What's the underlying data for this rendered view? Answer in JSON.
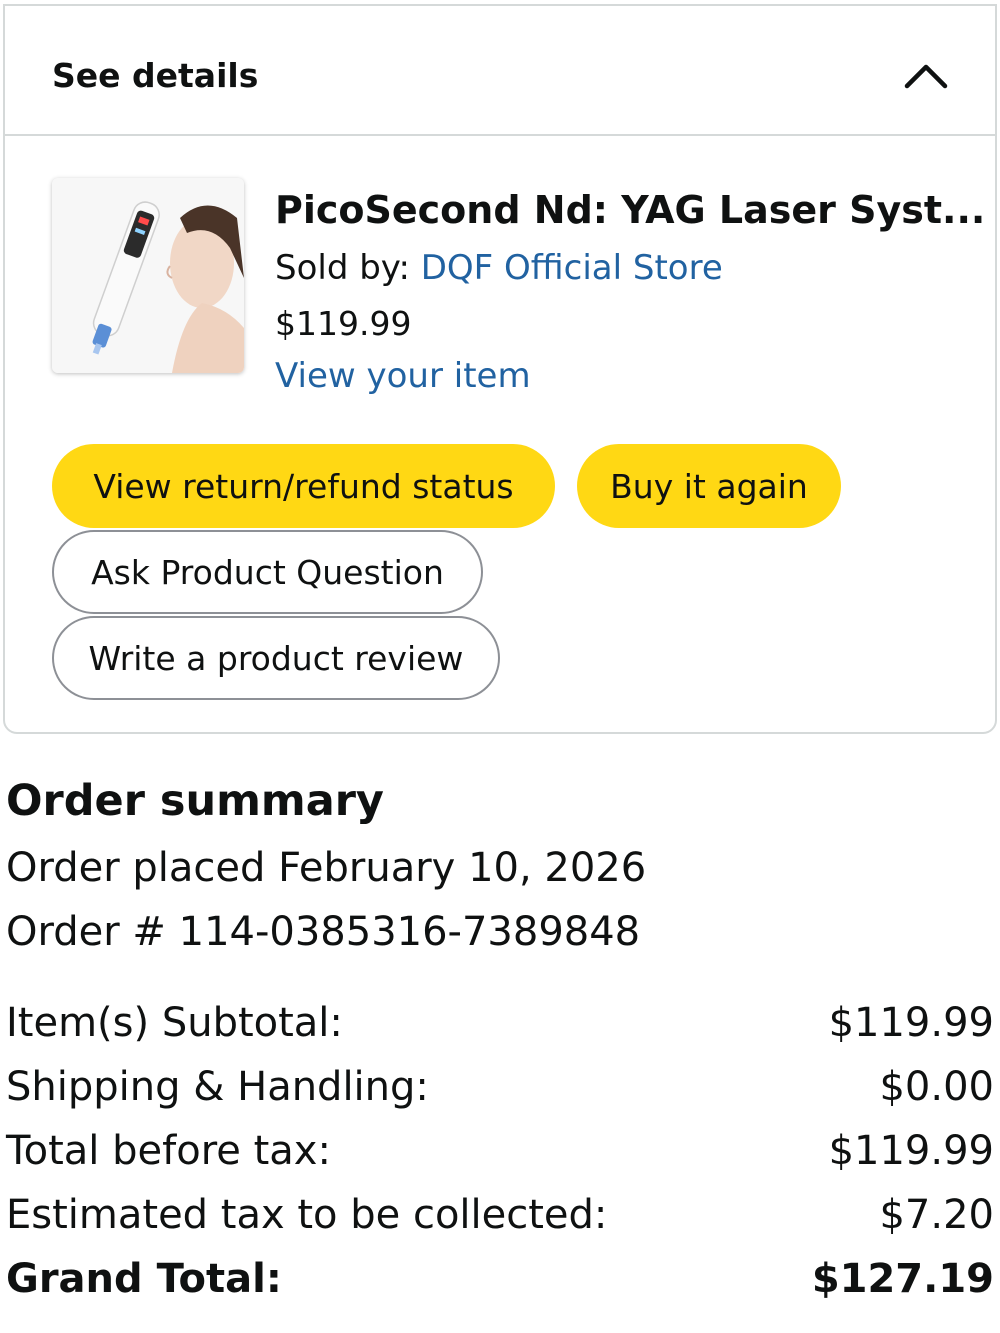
{
  "details_card": {
    "toggle_label": "See details",
    "toggle_icon": "chevron-up-icon",
    "item": {
      "title": "PicoSecond Nd: YAG Laser Syst...",
      "sold_by_label": "Sold by: ",
      "store_name": "DQF Official Store",
      "price": "$119.99",
      "view_item_label": "View your item"
    },
    "buttons": {
      "refund_status": "View return/refund status",
      "buy_again": "Buy it again",
      "ask_question": "Ask Product Question",
      "write_review": "Write a product review"
    }
  },
  "order_summary": {
    "title": "Order summary",
    "placed": "Order placed February 10, 2026",
    "order_number": "Order # 114-0385316-7389848",
    "rows": [
      {
        "label": "Item(s) Subtotal:",
        "value": "$119.99"
      },
      {
        "label": "Shipping & Handling:",
        "value": "$0.00"
      },
      {
        "label": "Total before tax:",
        "value": "$119.99"
      },
      {
        "label": "Estimated tax to be collected:",
        "value": "$7.20"
      },
      {
        "label": "Grand Total:",
        "value": "$127.19"
      }
    ]
  },
  "colors": {
    "button_yellow": "#ffd814",
    "link_blue": "#2162a1",
    "border_gray": "#d5d9d9"
  }
}
